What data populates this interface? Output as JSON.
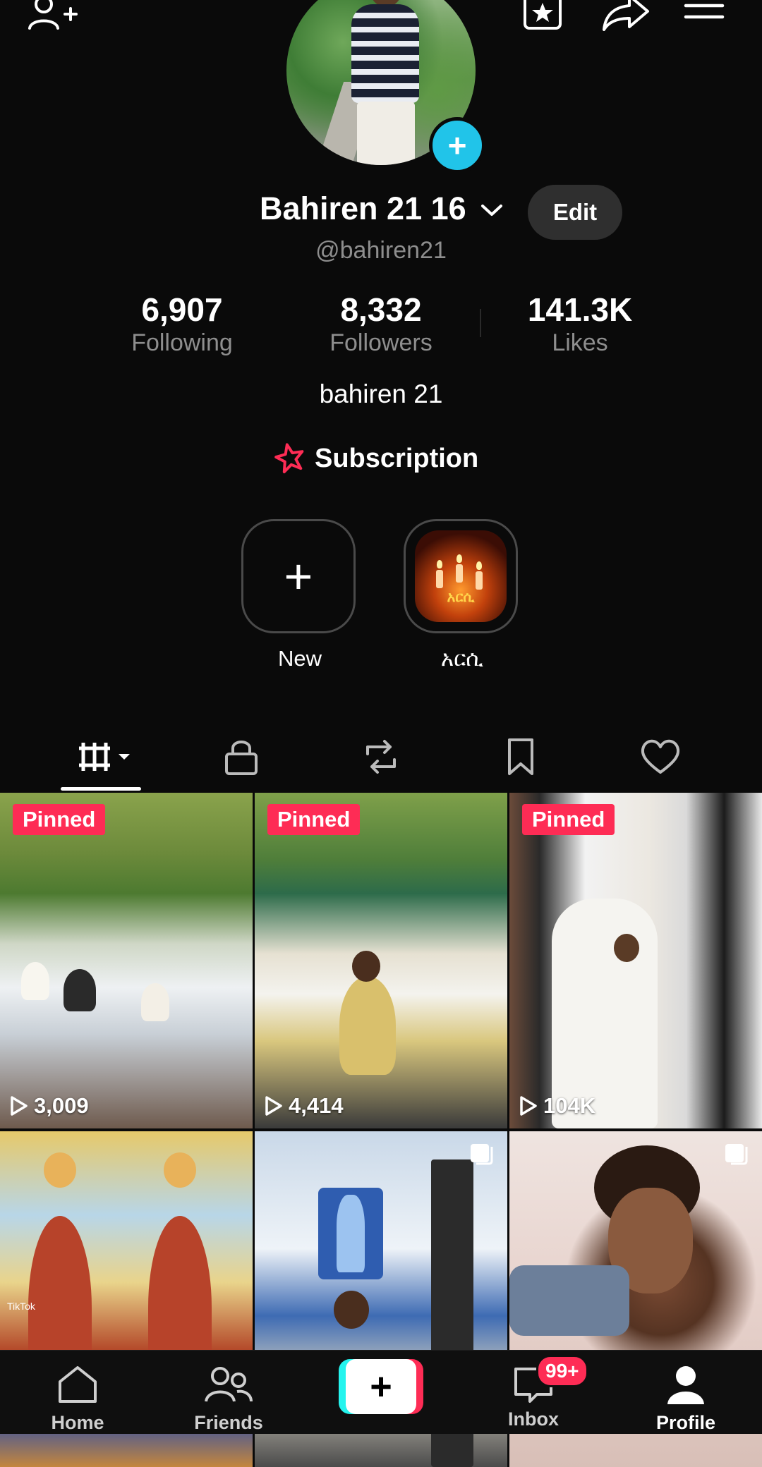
{
  "profile": {
    "display_name": "Bahiren 21 16",
    "username": "@bahiren21",
    "bio": "bahiren 21",
    "edit_label": "Edit"
  },
  "stats": [
    {
      "value": "6,907",
      "label": "Following"
    },
    {
      "value": "8,332",
      "label": "Followers"
    },
    {
      "value": "141.3K",
      "label": "Likes"
    }
  ],
  "subscription": {
    "label": "Subscription",
    "icon": "star-badge-icon"
  },
  "highlights": [
    {
      "label": "New",
      "icon": "plus-icon"
    },
    {
      "label": "አርሲ",
      "thumb_text": "አርሲ"
    }
  ],
  "tabs": [
    {
      "name": "videos",
      "icon": "grid-icon",
      "selected": true
    },
    {
      "name": "private",
      "icon": "lock-icon"
    },
    {
      "name": "reposts",
      "icon": "repost-icon"
    },
    {
      "name": "saved",
      "icon": "bookmark-icon"
    },
    {
      "name": "liked",
      "icon": "heart-icon"
    }
  ],
  "videos": [
    {
      "pinned_label": "Pinned",
      "views": "3,009"
    },
    {
      "pinned_label": "Pinned",
      "views": "4,414"
    },
    {
      "pinned_label": "Pinned",
      "views": "104K"
    },
    {
      "watermark": "TikTok"
    },
    {
      "multi": true
    },
    {
      "multi": true
    }
  ],
  "nav": {
    "home": "Home",
    "friends": "Friends",
    "inbox": "Inbox",
    "inbox_badge": "99+",
    "profile": "Profile"
  },
  "colors": {
    "accent_red": "#fe2c55",
    "accent_cyan": "#25f4ee",
    "avatar_add": "#21c4e9",
    "background": "#0a0a0a"
  }
}
